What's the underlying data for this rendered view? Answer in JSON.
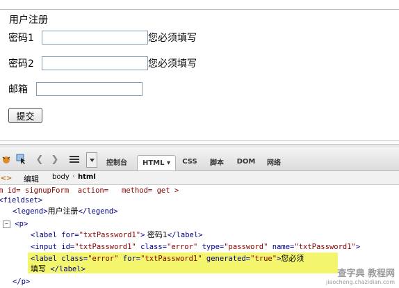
{
  "form": {
    "legend": "用户注册",
    "password1_label": "密码1",
    "password1_error": "您必须填写",
    "password2_label": "密码2",
    "password2_error": "您必须填写",
    "email_label": "邮箱",
    "submit_label": "提交"
  },
  "firebug": {
    "tabs": [
      "控制台",
      "HTML ▾",
      "CSS",
      "脚本",
      "DOM",
      "网络"
    ],
    "active_tab": "HTML",
    "edit_label": "编辑",
    "breadcrumb": [
      "body",
      "html"
    ],
    "code_lines": {
      "line1": "m id= signupForm  action=   method= get >",
      "line2": "fieldset>",
      "legend_text": "用户注册",
      "label_text": " 密码1",
      "error_text_a": "您必",
      "error_text_b": "须",
      "error_text_c": "填写"
    }
  },
  "watermark": {
    "line1": "查字典 教程网",
    "line2": "jiaocheng.chazidian.com"
  }
}
